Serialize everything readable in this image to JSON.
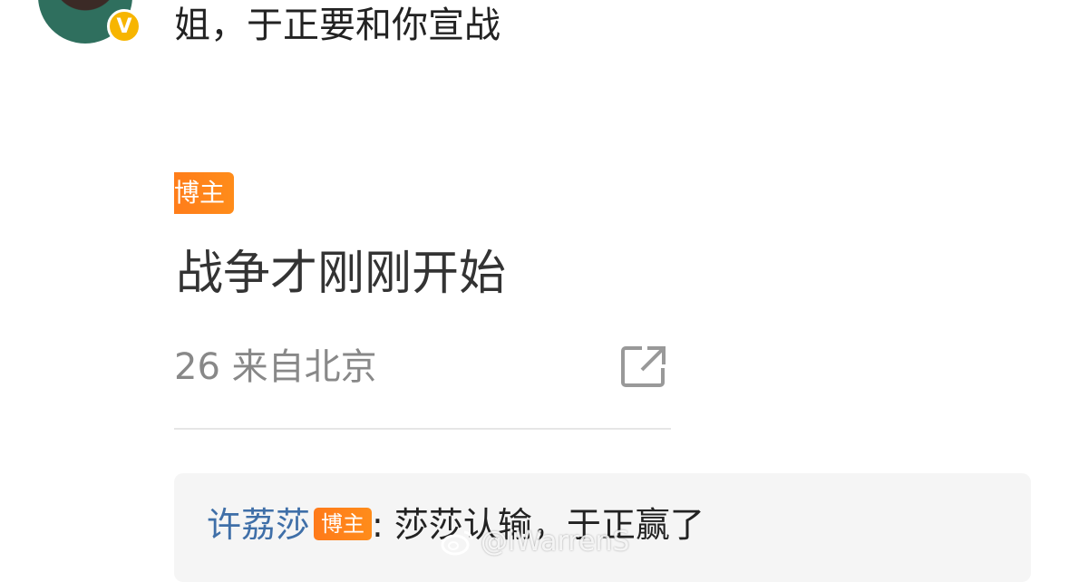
{
  "post": {
    "verified_badge": "V",
    "text": "姐，于正要和你宣战"
  },
  "quote": {
    "badge": "博主",
    "text": "战争才刚刚开始",
    "meta": "26  来自北京",
    "share_icon": "share-icon"
  },
  "reply": {
    "name": "许荔莎",
    "badge": "博主",
    "text": ": 莎莎认输，于正赢了"
  },
  "watermark": {
    "icon": "weibo-icon",
    "text": "@iWarrenS"
  },
  "colors": {
    "badge": "#ff7a1a",
    "link": "#3f6fa8",
    "verified": "#f7b500"
  }
}
